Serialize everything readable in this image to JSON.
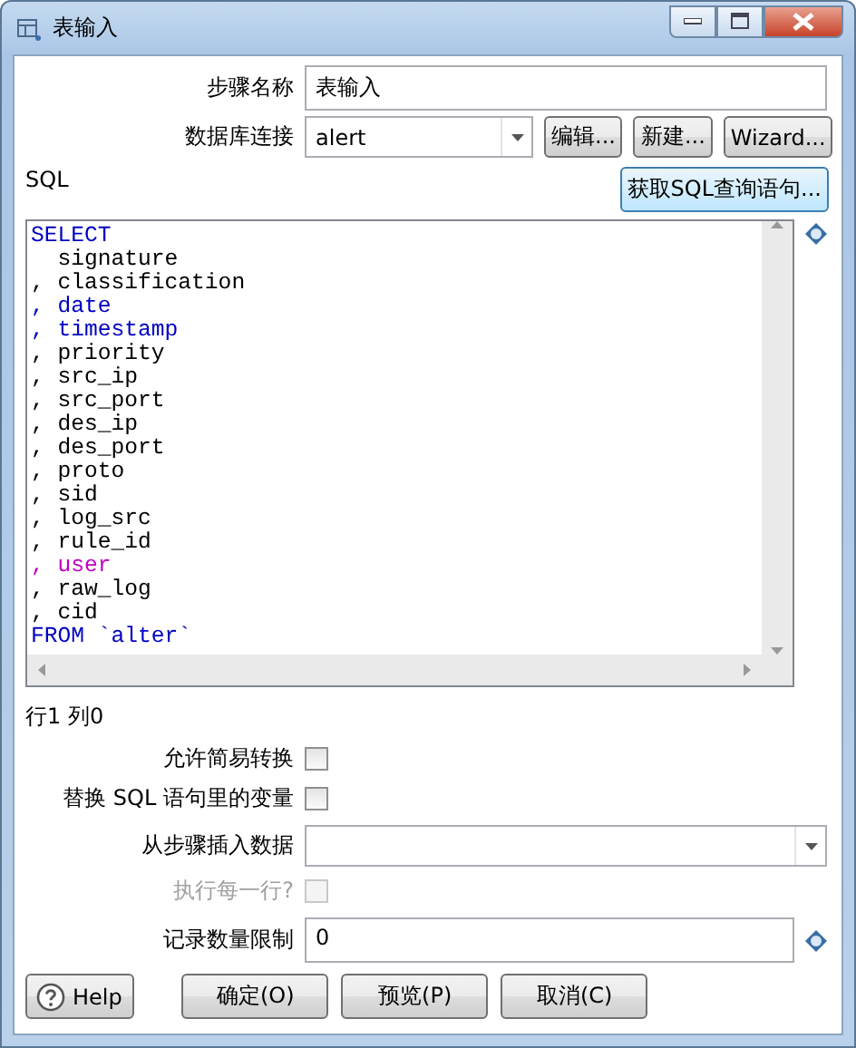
{
  "window": {
    "title": "表输入"
  },
  "step_name": {
    "label": "步骤名称",
    "value": "表输入"
  },
  "connection": {
    "label": "数据库连接",
    "value": "alert",
    "buttons": [
      "编辑...",
      "新建...",
      "Wizard..."
    ]
  },
  "sql": {
    "label": "SQL",
    "get_button": "获取SQL查询语句...",
    "lines": [
      {
        "text": "SELECT",
        "color": "#0000c0"
      },
      {
        "text": "  signature",
        "color": "#000000"
      },
      {
        "text": ", classification",
        "color": "#000000"
      },
      {
        "text": ", date",
        "color": "#0000c0"
      },
      {
        "text": ", timestamp",
        "color": "#0000c0"
      },
      {
        "text": ", priority",
        "color": "#000000"
      },
      {
        "text": ", src_ip",
        "color": "#000000"
      },
      {
        "text": ", src_port",
        "color": "#000000"
      },
      {
        "text": ", des_ip",
        "color": "#000000"
      },
      {
        "text": ", des_port",
        "color": "#000000"
      },
      {
        "text": ", proto",
        "color": "#000000"
      },
      {
        "text": ", sid",
        "color": "#000000"
      },
      {
        "text": ", log_src",
        "color": "#000000"
      },
      {
        "text": ", rule_id",
        "color": "#000000"
      },
      {
        "text": ", user",
        "color": "#c000c0"
      },
      {
        "text": ", raw_log",
        "color": "#000000"
      },
      {
        "text": ", cid",
        "color": "#000000"
      },
      {
        "text": "FROM `alter`",
        "color": "#0000c0"
      }
    ]
  },
  "cursor_position": "行1 列0",
  "options": [
    {
      "label": "允许简易转换",
      "checked": false,
      "disabled": false
    },
    {
      "label": "替换 SQL 语句里的变量",
      "checked": false,
      "disabled": false
    }
  ],
  "insert_from_step": {
    "label": "从步骤插入数据"
  },
  "execute_each_row": {
    "label": "执行每一行?",
    "checked": false,
    "disabled": true
  },
  "limit": {
    "label": "记录数量限制",
    "value": "0"
  },
  "buttons": {
    "help": "Help",
    "actions": [
      "确定(O)",
      "预览(P)",
      "取消(C)"
    ]
  }
}
